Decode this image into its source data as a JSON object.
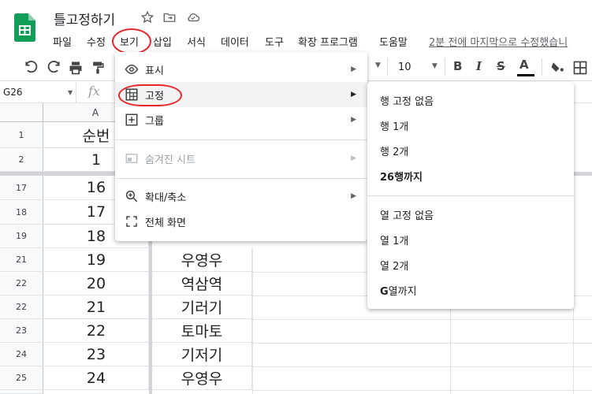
{
  "header": {
    "doc_title": "틀고정하기",
    "last_edit": "2분 전에 마지막으로 수정했습니",
    "menu": [
      "파일",
      "수정",
      "보기",
      "삽입",
      "서식",
      "데이터",
      "도구",
      "확장 프로그램",
      "도움말"
    ]
  },
  "toolbar": {
    "font_size": "10"
  },
  "formula": {
    "namebox": "G26",
    "fx": "fx"
  },
  "grid": {
    "col_a": "A",
    "rows": [
      {
        "num": "1",
        "a": "순번",
        "b": ""
      },
      {
        "num": "2",
        "a": "1",
        "b": ""
      },
      {
        "num": "17",
        "a": "16",
        "b": ""
      },
      {
        "num": "18",
        "a": "17",
        "b": ""
      },
      {
        "num": "19",
        "a": "18",
        "b": ""
      },
      {
        "num": "21",
        "a": "19",
        "b": "우영우"
      },
      {
        "num": "22",
        "a": "20",
        "b": "역삼역"
      },
      {
        "num": "22",
        "a": "21",
        "b": "기러기"
      },
      {
        "num": "23",
        "a": "22",
        "b": "토마토"
      },
      {
        "num": "24",
        "a": "23",
        "b": "기저기"
      },
      {
        "num": "25",
        "a": "24",
        "b": "우영우"
      }
    ]
  },
  "view_menu": {
    "items": [
      "표시",
      "고정",
      "그룹",
      "숨겨진 시트",
      "확대/축소",
      "전체 화면"
    ]
  },
  "freeze_submenu": {
    "rows": [
      "행 고정 없음",
      "행 1개",
      "행 2개"
    ],
    "row_upto_bold": "26",
    "row_upto_rest": "행까지",
    "cols": [
      "열 고정 없음",
      "열 1개",
      "열 2개"
    ],
    "col_upto_bold": "G",
    "col_upto_rest": "열까지"
  },
  "colors": {
    "sheets_green": "#0f9d58",
    "annotation_red": "#e8262b",
    "menu_highlight": "#f1f3f4"
  }
}
